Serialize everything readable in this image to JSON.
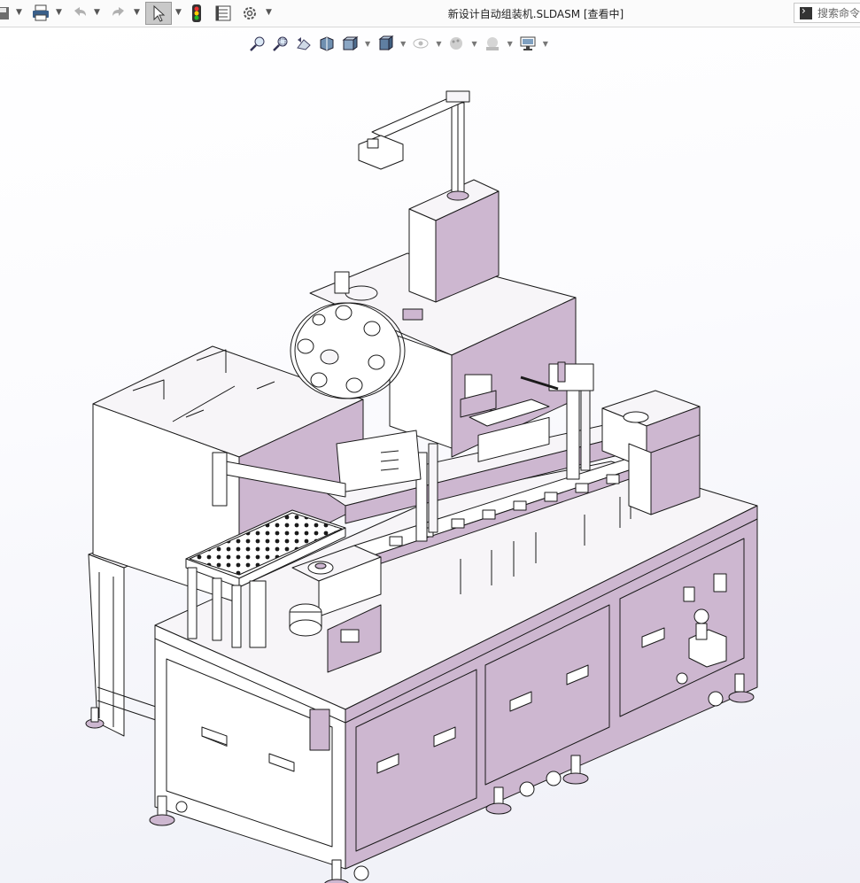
{
  "window": {
    "title": "新设计自动组装机.SLDASM [查看中]",
    "search_placeholder": "搜索命令"
  },
  "toolbar": {
    "items": [
      "save-icon",
      "print-icon",
      "undo-icon",
      "redo-icon",
      "select-icon",
      "rebuild-icon",
      "file-properties-icon",
      "options-icon"
    ],
    "select_active": true
  },
  "view_toolbar": {
    "items": [
      "zoom-to-fit-icon",
      "zoom-to-area-icon",
      "previous-view-icon",
      "section-view-icon",
      "view-orientation-icon",
      "display-style-icon",
      "hide-show-items-icon",
      "edit-appearance-icon",
      "apply-scene-icon",
      "view-settings-icon"
    ]
  },
  "colors": {
    "part_fill": "#cdb7d0",
    "part_fill_light": "#f7f5f8",
    "edge": "#1a1a1a",
    "background_top": "#ffffff",
    "background_bottom": "#eff0f7"
  }
}
